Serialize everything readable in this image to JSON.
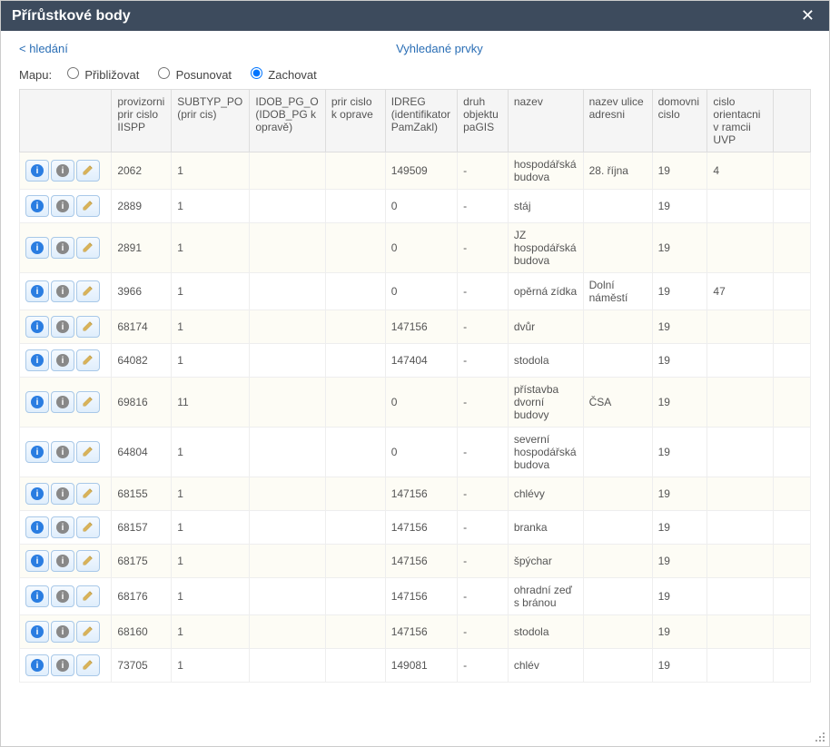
{
  "window": {
    "title": "Přírůstkové body"
  },
  "nav": {
    "back": "< hledání",
    "centerLabel": "Vyhledané prvky"
  },
  "mapControls": {
    "label": "Mapu:",
    "options": {
      "zoom": "Přibližovat",
      "pan": "Posunovat",
      "keep": "Zachovat"
    },
    "selected": "keep"
  },
  "table": {
    "headers": {
      "prir": "provizorni prir cislo IISPP",
      "subtyp": "SUBTYP_PO (prir cis)",
      "idobpg": "IDOB_PG_O (IDOB_PG k opravě)",
      "prirk": "prir cislo k oprave",
      "idreg": "IDREG (identifikator PamZakl)",
      "druh": "druh objektu paGIS",
      "nazev": "nazev",
      "ulice": "nazev ulice adresni",
      "domovni": "domovni cislo",
      "orient": "cislo orientacni v ramcii UVP"
    },
    "rows": [
      {
        "prir": "2062",
        "subtyp": "1",
        "idobpg": "",
        "prirk": "",
        "idreg": "149509",
        "druh": "-",
        "nazev": "hospodářská budova",
        "ulice": "28. října",
        "domovni": "19",
        "orient": "4"
      },
      {
        "prir": "2889",
        "subtyp": "1",
        "idobpg": "",
        "prirk": "",
        "idreg": "0",
        "druh": "-",
        "nazev": "stáj",
        "ulice": "",
        "domovni": "19",
        "orient": ""
      },
      {
        "prir": "2891",
        "subtyp": "1",
        "idobpg": "",
        "prirk": "",
        "idreg": "0",
        "druh": "-",
        "nazev": "JZ hospodářská budova",
        "ulice": "",
        "domovni": "19",
        "orient": ""
      },
      {
        "prir": "3966",
        "subtyp": "1",
        "idobpg": "",
        "prirk": "",
        "idreg": "0",
        "druh": "-",
        "nazev": "opěrná zídka",
        "ulice": "Dolní náměstí",
        "domovni": "19",
        "orient": "47"
      },
      {
        "prir": "68174",
        "subtyp": "1",
        "idobpg": "",
        "prirk": "",
        "idreg": "147156",
        "druh": "-",
        "nazev": "dvůr",
        "ulice": "",
        "domovni": "19",
        "orient": ""
      },
      {
        "prir": "64082",
        "subtyp": "1",
        "idobpg": "",
        "prirk": "",
        "idreg": "147404",
        "druh": "-",
        "nazev": "stodola",
        "ulice": "",
        "domovni": "19",
        "orient": ""
      },
      {
        "prir": "69816",
        "subtyp": "11",
        "idobpg": "",
        "prirk": "",
        "idreg": "0",
        "druh": "-",
        "nazev": "přístavba dvorní budovy",
        "ulice": "ČSA",
        "domovni": "19",
        "orient": ""
      },
      {
        "prir": "64804",
        "subtyp": "1",
        "idobpg": "",
        "prirk": "",
        "idreg": "0",
        "druh": "-",
        "nazev": "severní hospodářská budova",
        "ulice": "",
        "domovni": "19",
        "orient": ""
      },
      {
        "prir": "68155",
        "subtyp": "1",
        "idobpg": "",
        "prirk": "",
        "idreg": "147156",
        "druh": "-",
        "nazev": "chlévy",
        "ulice": "",
        "domovni": "19",
        "orient": ""
      },
      {
        "prir": "68157",
        "subtyp": "1",
        "idobpg": "",
        "prirk": "",
        "idreg": "147156",
        "druh": "-",
        "nazev": "branka",
        "ulice": "",
        "domovni": "19",
        "orient": ""
      },
      {
        "prir": "68175",
        "subtyp": "1",
        "idobpg": "",
        "prirk": "",
        "idreg": "147156",
        "druh": "-",
        "nazev": "špýchar",
        "ulice": "",
        "domovni": "19",
        "orient": ""
      },
      {
        "prir": "68176",
        "subtyp": "1",
        "idobpg": "",
        "prirk": "",
        "idreg": "147156",
        "druh": "-",
        "nazev": "ohradní zeď s bránou",
        "ulice": "",
        "domovni": "19",
        "orient": ""
      },
      {
        "prir": "68160",
        "subtyp": "1",
        "idobpg": "",
        "prirk": "",
        "idreg": "147156",
        "druh": "-",
        "nazev": "stodola",
        "ulice": "",
        "domovni": "19",
        "orient": ""
      },
      {
        "prir": "73705",
        "subtyp": "1",
        "idobpg": "",
        "prirk": "",
        "idreg": "149081",
        "druh": "-",
        "nazev": "chlév",
        "ulice": "",
        "domovni": "19",
        "orient": ""
      }
    ]
  }
}
